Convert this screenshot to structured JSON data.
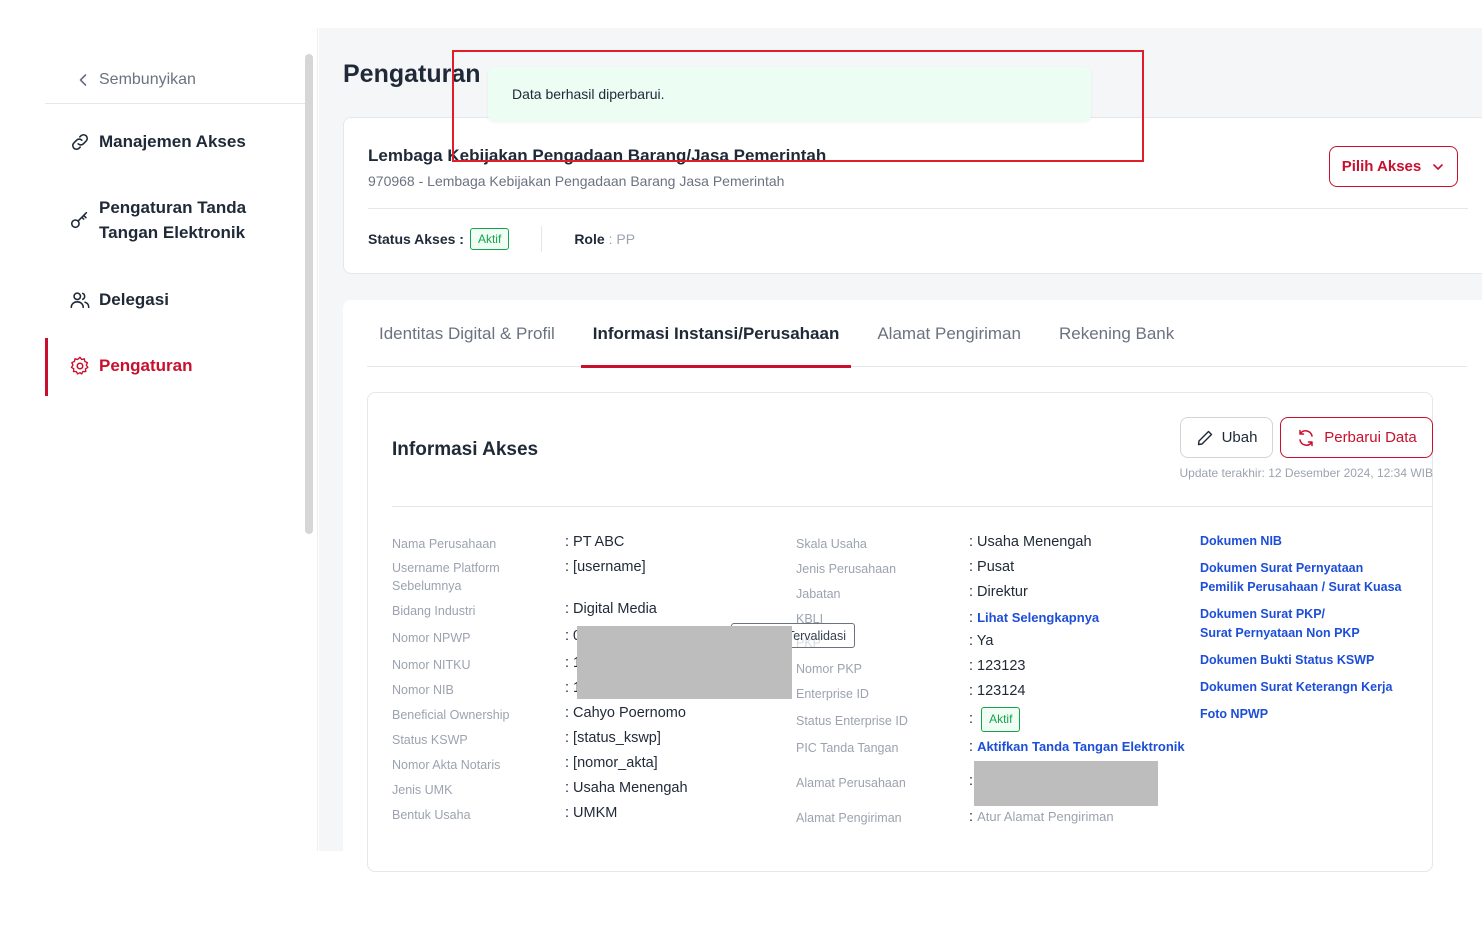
{
  "sidebar": {
    "hide_label": "Sembunyikan",
    "items": [
      {
        "label": "Manajemen Akses",
        "icon": "link-icon"
      },
      {
        "label_line1": "Pengaturan Tanda",
        "label_line2": "Tangan Elektronik",
        "icon": "key-icon"
      },
      {
        "label": "Delegasi",
        "icon": "users-icon"
      },
      {
        "label": "Pengaturan",
        "icon": "gear-icon",
        "active": true
      }
    ]
  },
  "page": {
    "title": "Pengaturan"
  },
  "toast": {
    "message": "Data berhasil diperbarui."
  },
  "organization": {
    "name": "Lembaga Kebijakan Pengadaan Barang/Jasa Pemerintah",
    "subtitle": "970968 - Lembaga Kebijakan Pengadaan Barang Jasa Pemerintah",
    "pilih_akses_label": "Pilih Akses",
    "status_label": "Status Akses :",
    "status_value": "Aktif",
    "role_label": "Role",
    "role_value": ": PP"
  },
  "tabs": [
    {
      "label": "Identitas Digital & Profil"
    },
    {
      "label": "Informasi Instansi/Perusahaan",
      "active": true
    },
    {
      "label": "Alamat Pengiriman"
    },
    {
      "label": "Rekening Bank"
    }
  ],
  "info": {
    "title": "Informasi Akses",
    "ubah_label": "Ubah",
    "perbarui_label": "Perbarui Data",
    "update_note": "Update terakhir: 12 Desember 2024, 12:34 WIB",
    "validasi_label": "Tervalidasi",
    "left_fields": [
      {
        "label": "Nama Perusahaan",
        "value": ": PT ABC"
      },
      {
        "label_line1": "Username Platform",
        "label_line2": "Sebelumnya",
        "value": ": [username]"
      },
      {
        "label": "Bidang Industri",
        "value": ": Digital Media"
      },
      {
        "label": "Nomor NPWP",
        "value": ": 0"
      },
      {
        "label": "Nomor NITKU",
        "value": ": 1"
      },
      {
        "label": "Nomor NIB",
        "value": ": 1"
      },
      {
        "label": "Beneficial Ownership",
        "value": ": Cahyo Poernomo"
      },
      {
        "label": "Status KSWP",
        "value": ": [status_kswp]"
      },
      {
        "label": "Nomor Akta Notaris",
        "value": ": [nomor_akta]"
      },
      {
        "label": "Jenis UMK",
        "value": ": Usaha Menengah"
      },
      {
        "label": "Bentuk Usaha",
        "value": ": UMKM"
      }
    ],
    "mid_fields": [
      {
        "label": "Skala Usaha",
        "value": ": Usaha Menengah"
      },
      {
        "label": "Jenis Perusahaan",
        "value": ": Pusat"
      },
      {
        "label": "Jabatan",
        "value": ": Direktur"
      },
      {
        "label": "KBLI",
        "value_prefix": ": ",
        "link": "Lihat Selengkapnya"
      },
      {
        "label": "PKP",
        "value": ": Ya"
      },
      {
        "label": "Nomor PKP",
        "value": ": 123123"
      },
      {
        "label": "Enterprise ID",
        "value": ": 123124"
      },
      {
        "label": "Status Enterprise ID",
        "value_prefix": ": ",
        "badge": "Aktif"
      },
      {
        "label": "PIC Tanda Tangan",
        "value_prefix": ": ",
        "link": "Aktifkan Tanda Tangan Elektronik"
      },
      {
        "label": "Alamat Perusahaan",
        "value": ":"
      },
      {
        "label": "Alamat Pengiriman",
        "value_prefix": ": ",
        "muted": "Atur Alamat Pengiriman"
      }
    ],
    "documents": [
      {
        "line1": "Dokumen NIB"
      },
      {
        "line1": "Dokumen Surat Pernyataan",
        "line2": "Pemilik Perusahaan / Surat Kuasa"
      },
      {
        "line1": "Dokumen Surat PKP/",
        "line2": "Surat Pernyataan Non PKP"
      },
      {
        "line1": "Dokumen Bukti Status KSWP"
      },
      {
        "line1": "Dokumen Surat Keterangn Kerja"
      },
      {
        "line1": "Foto NPWP"
      }
    ]
  },
  "colors": {
    "accent": "#c8102e",
    "success": "#16a34a",
    "link": "#1d4ed8",
    "toast_bg": "#ecfdf3",
    "highlight": "#e11d2a"
  }
}
